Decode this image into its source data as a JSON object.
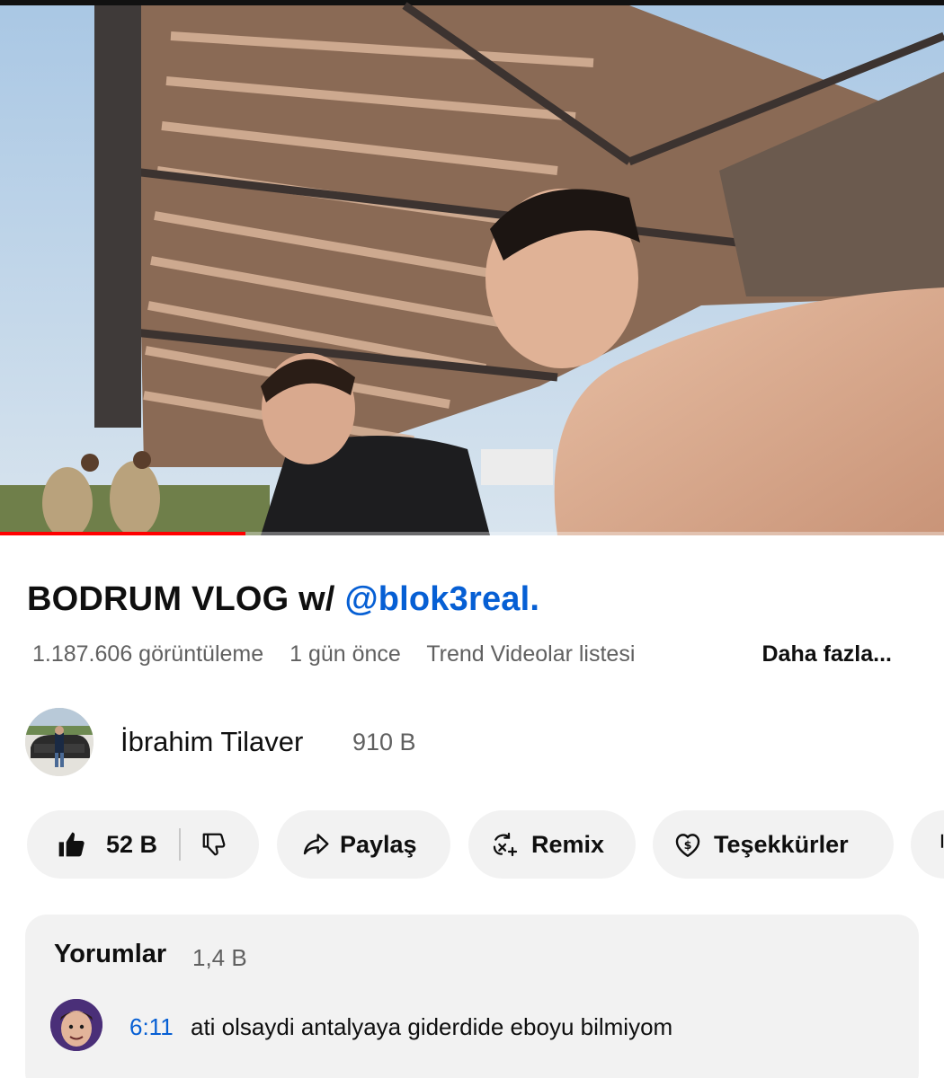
{
  "video": {
    "progress_fraction": 0.26,
    "buffer_fraction": 0.26
  },
  "title": {
    "text": "BODRUM VLOG w/",
    "mention": "@blok3real."
  },
  "meta": {
    "views": "1.187.606 görüntüleme",
    "age": "1 gün önce",
    "tag": "Trend Videolar listesi",
    "more_label": "Daha fazla..."
  },
  "channel": {
    "name": "İbrahim Tilaver",
    "subscribers": "910 B"
  },
  "actions": {
    "like_count": "52 B",
    "share_label": "Paylaş",
    "remix_label": "Remix",
    "thanks_label": "Teşekkürler"
  },
  "icons": {
    "like": "thumbs-up-icon",
    "dislike": "thumbs-down-icon",
    "share": "share-arrow-icon",
    "remix": "remix-icon",
    "thanks": "heart-dollar-icon"
  },
  "comments": {
    "title": "Yorumlar",
    "count": "1,4 B",
    "first": {
      "timestamp": "6:11",
      "text": "ati olsaydi antalyaya giderdide eboyu bilmiyom"
    }
  },
  "colors": {
    "link_blue": "#065fd4",
    "progress_red": "#ff0000",
    "pill_bg": "#f2f2f2",
    "secondary_text": "#606060"
  }
}
